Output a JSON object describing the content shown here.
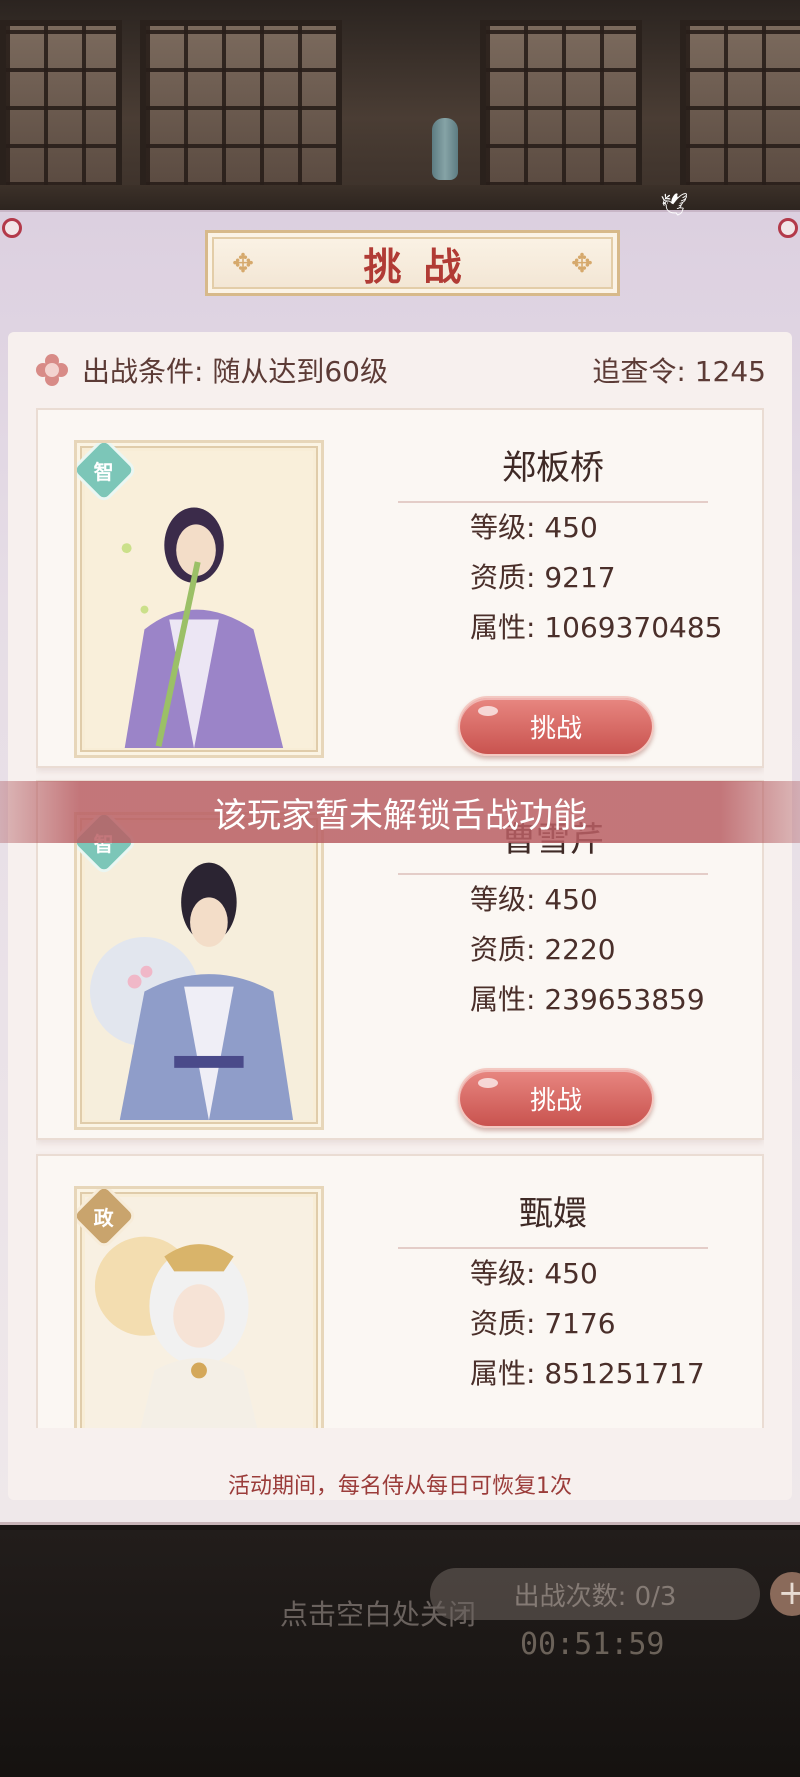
{
  "panel": {
    "title": "挑战",
    "condition_label": "出战条件: 随从达到60级",
    "token_label": "追查令: 1245",
    "footer_note": "活动期间，每名侍从每日可恢复1次"
  },
  "cards": [
    {
      "tag": "智",
      "name": "郑板桥",
      "level": "等级: 450",
      "aptitude": "资质: 9217",
      "attribute": "属性: 1069370485",
      "button": "挑战"
    },
    {
      "tag": "智",
      "name": "曹雪芹",
      "level": "等级: 450",
      "aptitude": "资质: 2220",
      "attribute": "属性: 239653859",
      "button": "挑战"
    },
    {
      "tag": "政",
      "name": "甄嬛",
      "level": "等级: 450",
      "aptitude": "资质: 7176",
      "attribute": "属性: 851251717"
    }
  ],
  "toast": "该玩家暂未解锁舌战功能",
  "bottom": {
    "close_hint": "点击空白处关闭",
    "battle_count": "出战次数: 0/3",
    "plus": "+",
    "timer": "00:51:59"
  },
  "colors": {
    "accent_red": "#c9534f",
    "title_red": "#b13b35",
    "tag_wisdom": "#7cc6b8",
    "tag_politics": "#c9a46d"
  }
}
